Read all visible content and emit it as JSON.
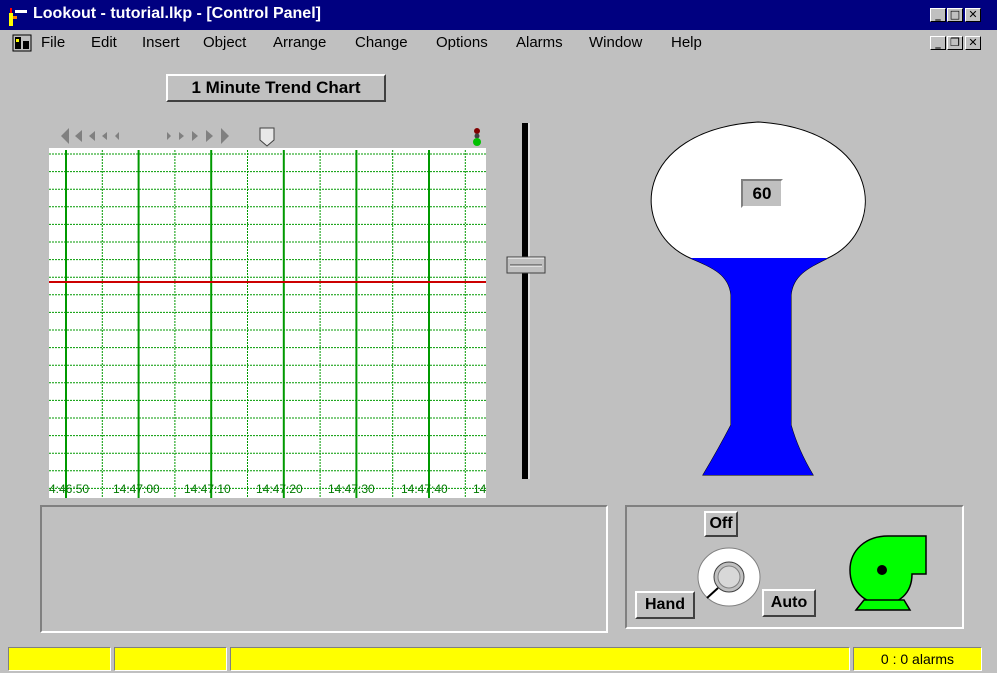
{
  "window": {
    "title": "Lookout - tutorial.lkp - [Control Panel]",
    "min_glyph": "_",
    "max_glyph": "□",
    "restore_glyph": "❐",
    "close_glyph": "✕",
    "app_icon": "lookout-app-icon"
  },
  "menu": {
    "items": [
      {
        "label": "File",
        "accel": "F"
      },
      {
        "label": "Edit",
        "accel": "E"
      },
      {
        "label": "Insert",
        "accel": "I"
      },
      {
        "label": "Object",
        "accel": "b"
      },
      {
        "label": "Arrange",
        "accel": "r"
      },
      {
        "label": "Change",
        "accel": "C"
      },
      {
        "label": "Options",
        "accel": "O"
      },
      {
        "label": "Alarms",
        "accel": "A"
      },
      {
        "label": "Window",
        "accel": "W"
      },
      {
        "label": "Help",
        "accel": "H"
      }
    ]
  },
  "trend": {
    "button_label": "1 Minute Trend Chart",
    "time_labels": [
      "4:46:50",
      "14:47:00",
      "14:47:10",
      "14:47:20",
      "14:47:30",
      "14:47:40",
      "14"
    ],
    "line_color": "#cc0000",
    "grid_color": "#009900"
  },
  "tank": {
    "value": "60",
    "fill_color": "#0000ff"
  },
  "switch": {
    "off_label": "Off",
    "hand_label": "Hand",
    "auto_label": "Auto"
  },
  "pump": {
    "color": "#00ff00"
  },
  "status": {
    "alarms_text": "0 : 0 alarms",
    "segment_color": "#ffff00"
  },
  "icons": [
    "lookout-app-icon",
    "document-icon",
    "minimize-icon",
    "maximize-icon",
    "close-icon",
    "restore-icon",
    "scroll-left-icon",
    "scroll-right-icon",
    "cursor-marker-icon",
    "traffic-light-icon",
    "pump-icon",
    "knob-icon"
  ]
}
